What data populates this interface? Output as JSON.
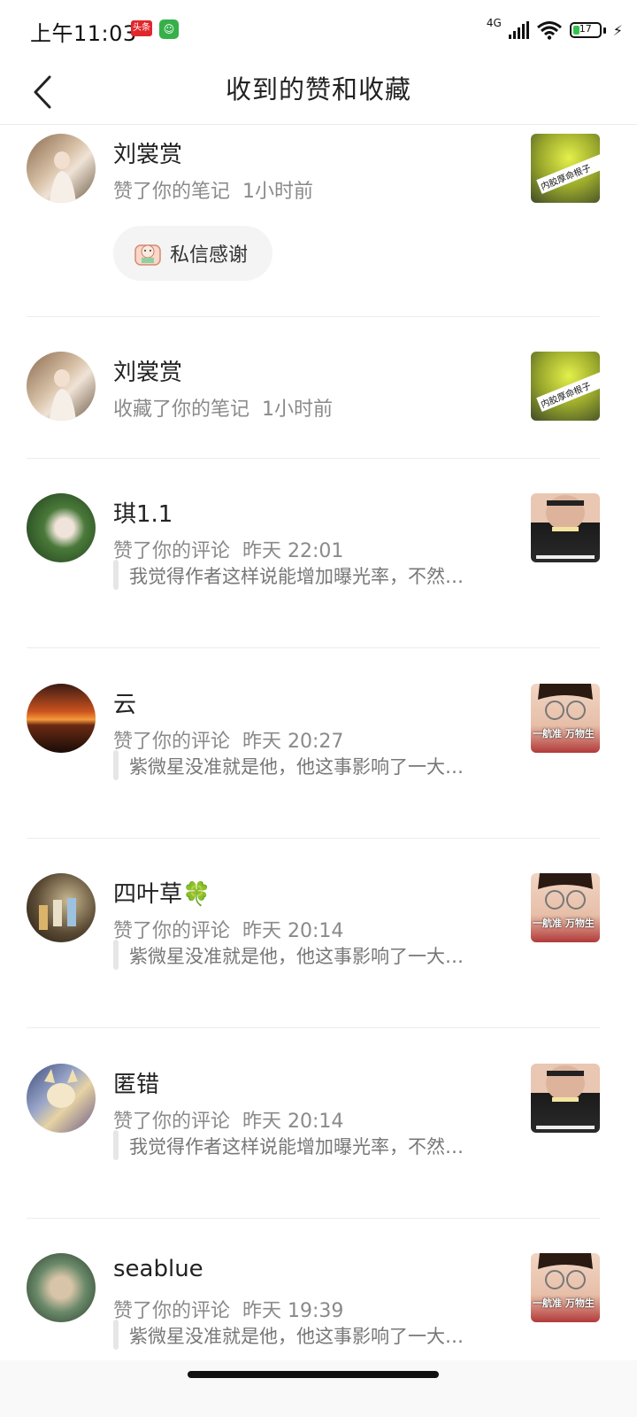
{
  "status_bar": {
    "time": "上午11:03",
    "badge_red": "头条",
    "network": "4G",
    "battery": "17"
  },
  "header": {
    "title": "收到的赞和收藏"
  },
  "items": [
    {
      "name": "刘裳赏",
      "action": "赞了你的笔记",
      "time": "1小时前",
      "button": "私信感谢",
      "thumb_text": "内胶厚命根子"
    },
    {
      "name": "刘裳赏",
      "action": "收藏了你的笔记",
      "time": "1小时前",
      "thumb_text": "内胶厚命根子"
    },
    {
      "name": "琪1.1",
      "action": "赞了你的评论",
      "time": "昨天 22:01",
      "quote": "我觉得作者这样说能增加曝光率，不然…"
    },
    {
      "name": "云",
      "action": "赞了你的评论",
      "time": "昨天 20:27",
      "quote": "紫微星没准就是他，他这事影响了一大…",
      "thumb_text": "一航准 万物生"
    },
    {
      "name": "四叶草🍀",
      "action": "赞了你的评论",
      "time": "昨天 20:14",
      "quote": "紫微星没准就是他，他这事影响了一大…",
      "thumb_text": "一航准 万物生"
    },
    {
      "name": "匿错",
      "action": "赞了你的评论",
      "time": "昨天 20:14",
      "quote": "我觉得作者这样说能增加曝光率，不然…"
    },
    {
      "name": "seablue",
      "action": "赞了你的评论",
      "time": "昨天 19:39",
      "quote": "紫微星没准就是他，他这事影响了一大…",
      "thumb_text": "一航准 万物生"
    }
  ]
}
